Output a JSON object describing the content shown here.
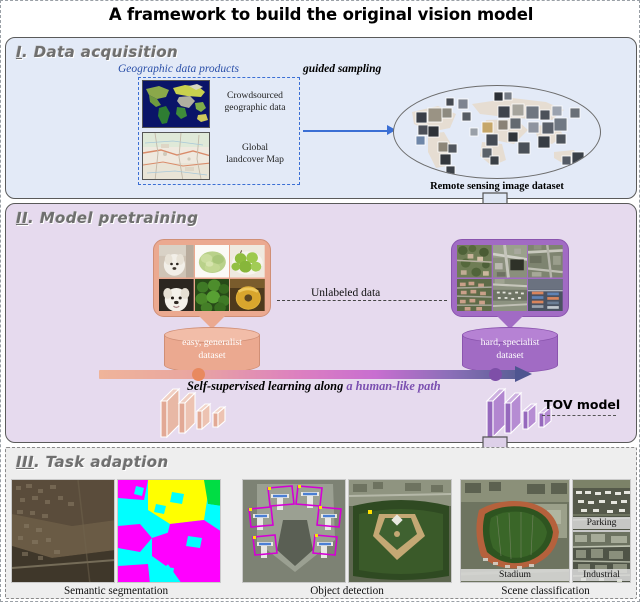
{
  "figure": {
    "title": "A framework to build the original vision model"
  },
  "section1": {
    "heading_numeral": "I",
    "heading_rest": ". Data acquisition",
    "geographic_products_label": "Geographic data products",
    "guided_sampling_label": "guided sampling",
    "sources": [
      {
        "caption": "Crowdsourced\ngeographic data",
        "line1": "Crowdsourced",
        "line2": "geographic data",
        "thumb": "world-landcover-map"
      },
      {
        "caption": "Global\nlandcover Map",
        "line1": "Global",
        "line2": "landcover Map",
        "thumb": "street-map"
      }
    ],
    "dataset_oval_caption": "Remote sensing image dataset"
  },
  "section2": {
    "heading_numeral": "II",
    "heading_rest": ". Model pretraining",
    "easy_card_images": [
      "dog-white-terrier",
      "broccoli-head",
      "green-apples-plate",
      "dog-white-fluffy",
      "broccoli-florets",
      "donut-glazed"
    ],
    "hard_card_images": [
      "aerial-suburb-trees",
      "aerial-highway-interchange",
      "aerial-industrial-roads",
      "aerial-dense-housing",
      "aerial-parking-lot",
      "aerial-port-containers"
    ],
    "easy_dataset_label_line1": "easy, generalist",
    "easy_dataset_label_line2": "dataset",
    "hard_dataset_label_line1": "hard, specialist",
    "hard_dataset_label_line2": "dataset",
    "unlabeled_label": "Unlabeled data",
    "ssl_text_plain": "Self-supervised learning along ",
    "ssl_text_highlight": "a human-like path",
    "tov_model_label": "TOV model"
  },
  "section3": {
    "heading_numeral": "III",
    "heading_rest": ". Task adaption",
    "tasks": [
      {
        "caption": "Semantic segmentation",
        "images": [
          "aerial-rural-scene",
          "segmentation-mask-colored"
        ]
      },
      {
        "caption": "Object detection",
        "images": [
          "airport-airplanes-boxes",
          "baseball-field"
        ]
      },
      {
        "caption": "Scene classification",
        "images": [
          "stadium-track-aerial",
          "parking-lot-aerial",
          "industrial-area-aerial"
        ],
        "scene_labels": [
          "Stadium",
          "Parking",
          "Industrial"
        ]
      }
    ]
  },
  "colors": {
    "section1_bg": "#e3eaf7",
    "section2_bg": "#e6daee",
    "section3_bg": "#eeeeee",
    "geo_label_blue": "#2a4fa8",
    "easy_salmon": "#eba990",
    "hard_purple": "#a16bc4",
    "highlight_purple": "#7a4fb0",
    "arrow_blue": "#3b6fd4"
  }
}
